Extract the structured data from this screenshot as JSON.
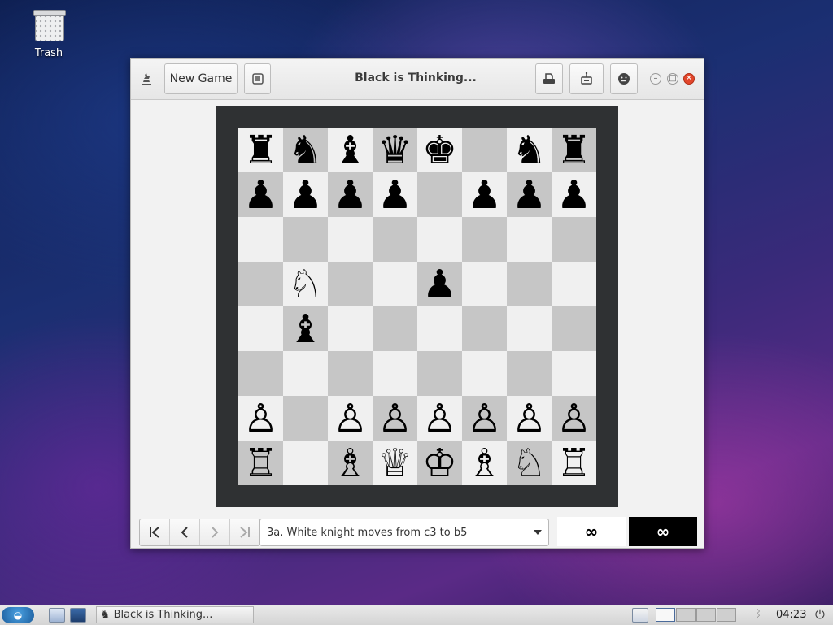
{
  "desktop": {
    "trash_label": "Trash"
  },
  "window": {
    "title": "Black is Thinking...",
    "new_game_label": "New Game",
    "icons": {
      "left": "chess-piece-icon",
      "fullscreen": "fullscreen-icon",
      "save": "save-icon",
      "print": "print-icon",
      "emote": "face-icon"
    }
  },
  "board": {
    "ranks": [
      [
        "♜",
        "♞",
        "♝",
        "♛",
        "♚",
        "",
        "♞",
        "♜"
      ],
      [
        "♟",
        "♟",
        "♟",
        "♟",
        "",
        "♟",
        "♟",
        "♟"
      ],
      [
        "",
        "",
        "",
        "",
        "",
        "",
        "",
        ""
      ],
      [
        "",
        "♘",
        "",
        "",
        "♟",
        "",
        "",
        ""
      ],
      [
        "",
        "♝",
        "",
        "",
        "",
        "",
        "",
        ""
      ],
      [
        "",
        "",
        "",
        "",
        "",
        "",
        "",
        ""
      ],
      [
        "♙",
        "",
        "♙",
        "♙",
        "♙",
        "♙",
        "♙",
        "♙"
      ],
      [
        "♖",
        "",
        "♗",
        "♕",
        "♔",
        "♗",
        "♘",
        "♖"
      ]
    ]
  },
  "bottom": {
    "nav": {
      "first": "first-move-icon",
      "prev": "previous-move-icon",
      "next": "next-move-icon",
      "last": "last-move-icon"
    },
    "move_text": "3a. White knight moves from c3 to b5",
    "white_clock": "∞",
    "black_clock": "∞"
  },
  "taskbar": {
    "task_label": "Black is Thinking...",
    "clock": "04:23"
  },
  "colors": {
    "light_square": "#f0f0f0",
    "dark_square": "#c6c6c6",
    "board_frame": "#2f3133",
    "close_button": "#e2462b"
  }
}
